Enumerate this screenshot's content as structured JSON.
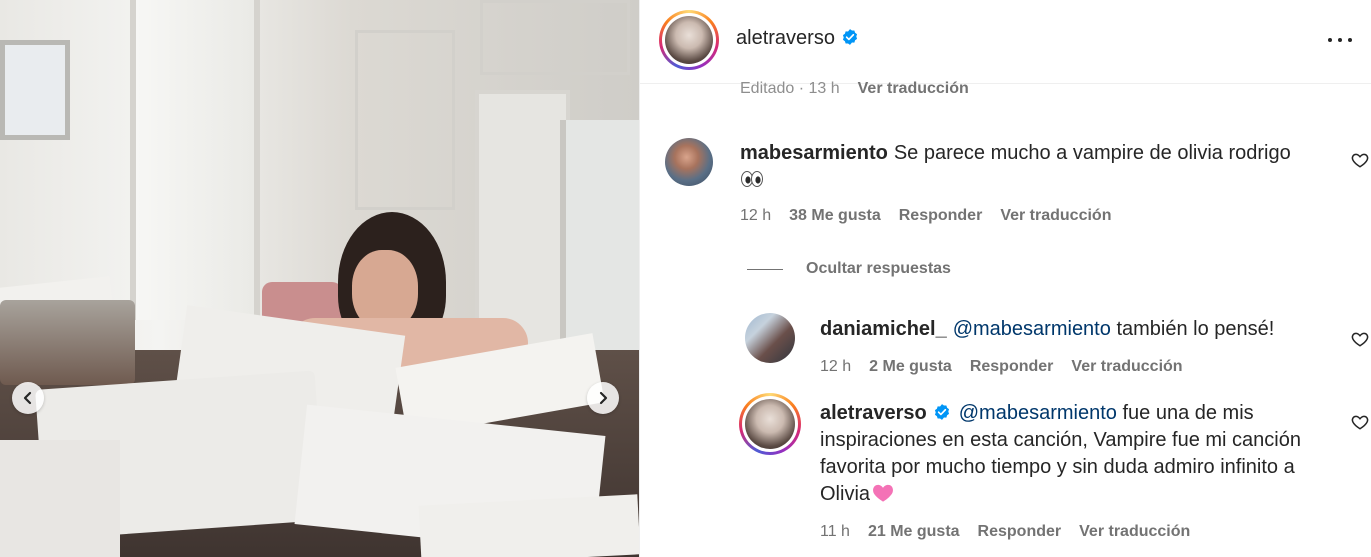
{
  "post": {
    "author": "aletraverso",
    "verified": true,
    "meta_edited": "Editado · 13 h",
    "meta_translate": "Ver traducción"
  },
  "photo": {
    "prev_icon": "chevron-left-icon",
    "next_icon": "chevron-right-icon"
  },
  "comments": [
    {
      "user": "mabesarmiento",
      "text": "Se parece mucho a vampire de olivia rodrigo",
      "emoji": "eyes-emoji",
      "time": "12 h",
      "likes": "38 Me gusta",
      "reply": "Responder",
      "translate": "Ver traducción"
    }
  ],
  "hide_replies": "Ocultar respuestas",
  "replies": [
    {
      "user": "daniamichel_",
      "mention": "@mabesarmiento",
      "text": "también lo pensé!",
      "time": "12 h",
      "likes": "2 Me gusta",
      "reply": "Responder",
      "translate": "Ver traducción"
    },
    {
      "user": "aletraverso",
      "verified": true,
      "mention": "@mabesarmiento",
      "text": "fue una de mis inspiraciones en esta canción, Vampire fue mi canción favorita por mucho tiempo y sin duda admiro infinito a Olivia",
      "emoji": "pink-heart-emoji",
      "time": "11 h",
      "likes": "21 Me gusta",
      "reply": "Responder",
      "translate": "Ver traducción"
    }
  ],
  "colors": {
    "text": "#262626",
    "secondary": "#737373",
    "mention": "#00376b",
    "verified": "#0095f6",
    "emoji_heart": "#f472b6"
  }
}
